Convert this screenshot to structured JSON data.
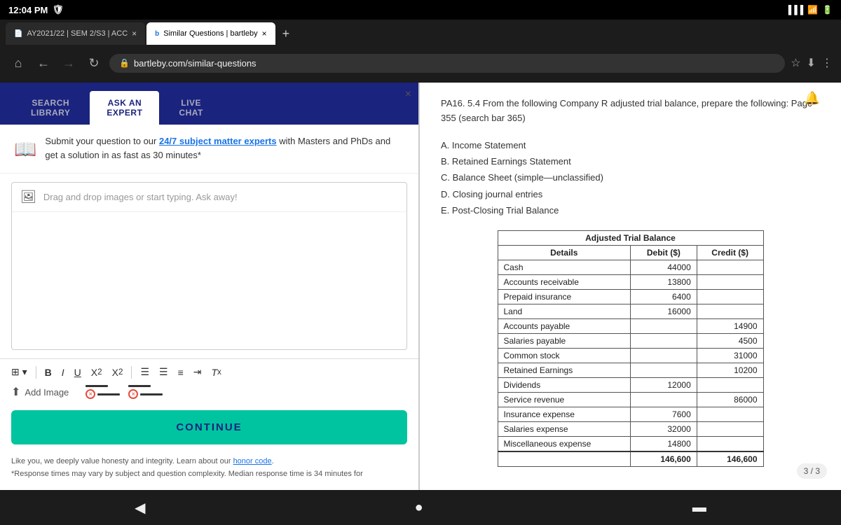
{
  "status_bar": {
    "time": "12:04 PM",
    "shield_icon": "🛡️"
  },
  "tabs": [
    {
      "id": "tab1",
      "title": "AY2021/22 | SEM 2/S3 | ACC",
      "favicon": "📄",
      "active": false
    },
    {
      "id": "tab2",
      "title": "Similar Questions | bartleby",
      "favicon": "b",
      "active": true
    }
  ],
  "address_bar": {
    "url": "bartleby.com/similar-questions"
  },
  "left_panel": {
    "close_label": "×",
    "nav_tabs": [
      {
        "id": "search",
        "label": "SEARCH\nLIBRARY",
        "active": false
      },
      {
        "id": "ask",
        "label": "ASK AN\nEXPERT",
        "active": true
      },
      {
        "id": "live",
        "label": "LIVE\nCHAT",
        "active": false
      }
    ],
    "expert_info": "Submit your question to our 24/7 subject matter experts with Masters and PhDs and get a solution in as fast as 30 minutes*",
    "expert_link_text": "24/7 subject matter experts",
    "placeholder": "Drag and drop images or start typing. Ask away!",
    "toolbar_items": [
      {
        "id": "table",
        "symbol": "⊞"
      },
      {
        "id": "bold",
        "symbol": "B"
      },
      {
        "id": "italic",
        "symbol": "I"
      },
      {
        "id": "underline",
        "symbol": "U"
      },
      {
        "id": "superscript",
        "symbol": "X²"
      },
      {
        "id": "subscript",
        "symbol": "X₂"
      },
      {
        "id": "unordered-list",
        "symbol": "≡"
      },
      {
        "id": "ordered-list",
        "symbol": "≡"
      },
      {
        "id": "align-left",
        "symbol": "≡"
      },
      {
        "id": "indent",
        "symbol": "⇥"
      },
      {
        "id": "clear-format",
        "symbol": "Ᵽ"
      }
    ],
    "add_image_label": "Add Image",
    "continue_button": "CONTINUE",
    "footer_line1": "Like you, we deeply value honesty and integrity. Learn about our ",
    "honor_code_text": "honor code",
    "footer_line2": "*Response times may vary by subject and question complexity. Median response time is 34 minutes for"
  },
  "right_panel": {
    "page_indicator": "3 / 3",
    "question_title": "PA16. 5.4 From the following Company R adjusted trial balance, prepare the following: Page 355 (search bar 365)",
    "options": [
      "A. Income Statement",
      "B. Retained Earnings Statement",
      "C. Balance Sheet (simple—unclassified)",
      "D. Closing journal entries",
      "E. Post-Closing Trial Balance"
    ],
    "table": {
      "title": "Adjusted Trial Balance",
      "columns": [
        "Details",
        "Debit ($)",
        "Credit ($)"
      ],
      "rows": [
        {
          "label": "Cash",
          "debit": "44000",
          "credit": ""
        },
        {
          "label": "Accounts receivable",
          "debit": "13800",
          "credit": ""
        },
        {
          "label": "Prepaid insurance",
          "debit": "6400",
          "credit": ""
        },
        {
          "label": "Land",
          "debit": "16000",
          "credit": ""
        },
        {
          "label": "Accounts payable",
          "debit": "",
          "credit": "14900"
        },
        {
          "label": "Salaries payable",
          "debit": "",
          "credit": "4500"
        },
        {
          "label": "Common stock",
          "debit": "",
          "credit": "31000"
        },
        {
          "label": "Retained Earnings",
          "debit": "",
          "credit": "10200"
        },
        {
          "label": "Dividends",
          "debit": "12000",
          "credit": ""
        },
        {
          "label": "Service revenue",
          "debit": "",
          "credit": "86000"
        },
        {
          "label": "Insurance expense",
          "debit": "7600",
          "credit": ""
        },
        {
          "label": "Salaries expense",
          "debit": "32000",
          "credit": ""
        },
        {
          "label": "Miscellaneous expense",
          "debit": "14800",
          "credit": ""
        }
      ],
      "totals": {
        "debit": "146,600",
        "credit": "146,600"
      }
    }
  },
  "bottom_nav": {
    "back": "◀",
    "home": "●",
    "menu": "▬"
  }
}
